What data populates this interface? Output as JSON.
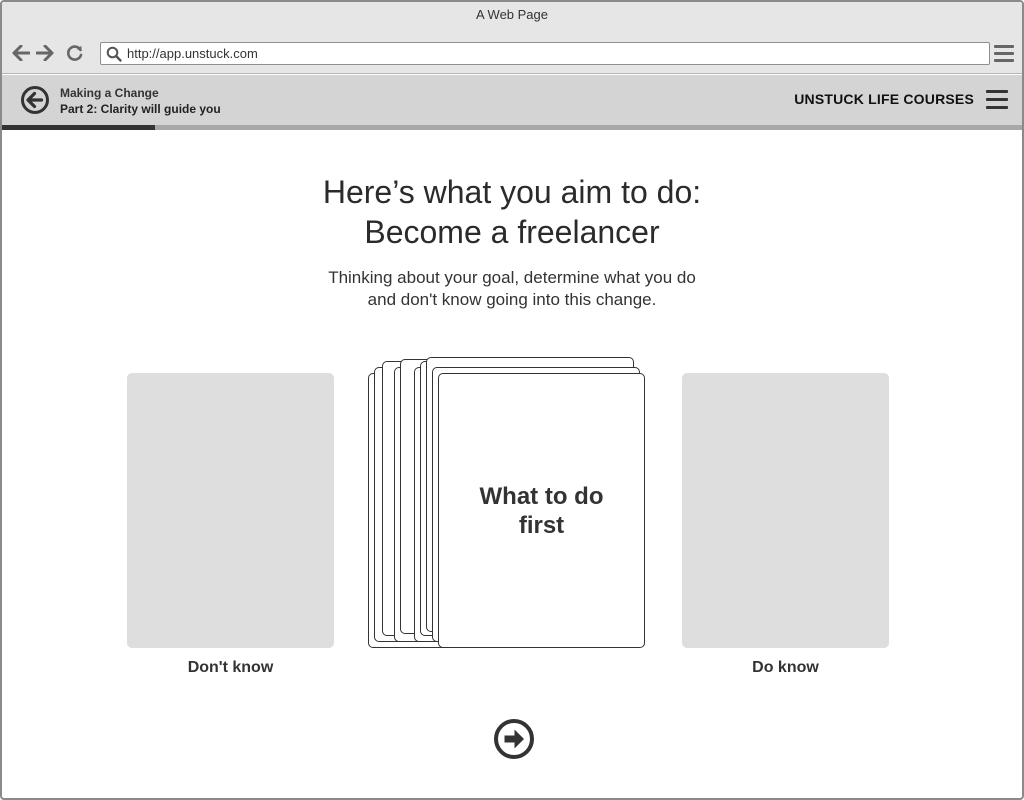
{
  "window": {
    "title": "A Web Page"
  },
  "browser": {
    "url": "http://app.unstuck.com",
    "back_icon": "arrow-left-icon",
    "forward_icon": "arrow-right-icon",
    "reload_icon": "reload-icon",
    "search_icon": "search-icon",
    "menu_icon": "hamburger-icon"
  },
  "header": {
    "course_title": "Making a Change",
    "course_part": "Part 2: Clarity will guide you",
    "brand": "UNSTUCK LIFE COURSES",
    "progress": 0.15
  },
  "main": {
    "heading_line1": "Here’s what you aim to do:",
    "heading_line2": "Become a freelancer",
    "subheading_line1": "Thinking about your goal, determine what you do",
    "subheading_line2": "and don't know going into this change.",
    "card_text": "What to do first",
    "left_bucket_label": "Don't know",
    "right_bucket_label": "Do know"
  },
  "colors": {
    "accent": "#333333",
    "bucket": "#dedede",
    "header_bg": "#d4d4d4"
  }
}
